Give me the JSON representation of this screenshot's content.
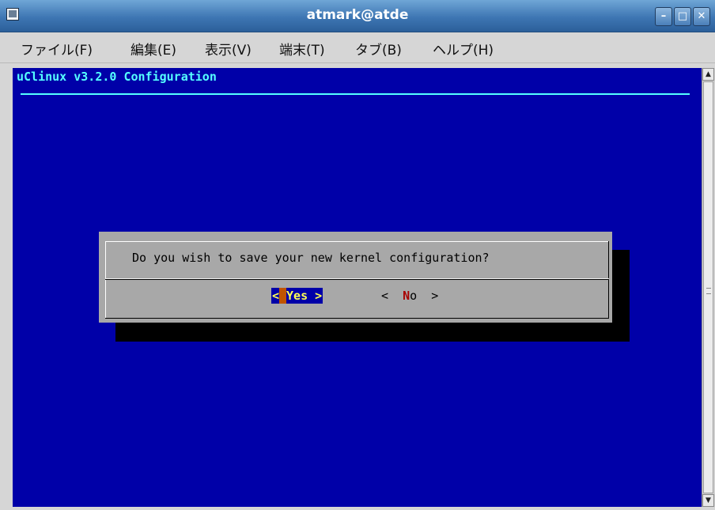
{
  "window": {
    "title": "atmark@atde",
    "controls": {
      "minimize": "–",
      "maximize": "□",
      "close": "✕"
    }
  },
  "menu": {
    "items": [
      "ファイル(F)",
      "編集(E)",
      "表示(V)",
      "端末(T)",
      "タブ(B)",
      "ヘルプ(H)"
    ]
  },
  "terminal": {
    "header": "uClinux v3.2.0 Configuration",
    "background": "#0000a8",
    "accent": "#55ffff"
  },
  "dialog": {
    "question": "Do you wish to save your new kernel configuration?",
    "yes_open": "<",
    "yes_label": "Yes",
    "yes_close": ">",
    "no_open": "<",
    "no_label_hot": "N",
    "no_label_rest": "o",
    "no_close": ">"
  },
  "scrollbar": {
    "up_icon": "▲",
    "down_icon": "▼"
  }
}
